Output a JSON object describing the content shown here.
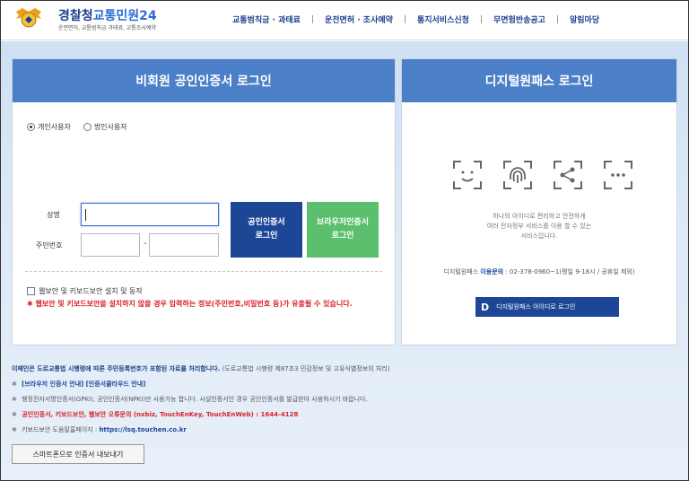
{
  "header": {
    "logo_title_main": "경찰청",
    "logo_title_accent": "교통민원24",
    "logo_sub": "운전면허, 교통범칙금 과태료, 교통조사예약",
    "nav": [
      "교통범칙금 · 과태료",
      "운전면허 · 조사예약",
      "통지서비스신청",
      "무면험반송공고",
      "알림마당"
    ]
  },
  "left_panel": {
    "title": "비회원 공인인증서 로그인",
    "radio_personal": "개인사용자",
    "radio_corporate": "법인사용자",
    "name_label": "성명",
    "rrn_label": "주민번호",
    "dash": "-",
    "cert_login_label": "공인인증서\n로그인",
    "browser_cert_label": "브라우저인증서\n로그인",
    "checkbox_label": "웹보안 및 키보드보안 설치 및 동작",
    "warning": "✱ 웹보안 및 키보드보안을 설치하지 않을 경우 입력하는 정보(주민번호,비밀번호 등)가 유출될 수 있습니다."
  },
  "right_panel": {
    "title": "디지털원패스 로그인",
    "desc_line1": "하나의 아이디로 편리하고 안전하게",
    "desc_line2": "여러 전자정부 서비스를 이용 할 수 있는",
    "desc_line3": "서비스입니다.",
    "contact_prefix": "디지털원패스",
    "contact_hl": "이용문의",
    "contact_suffix": ": 02-378-0960~1(평일 9-18시 / 공휴일 제외)",
    "button_d": "D",
    "button_label": "디지털원패스 아이디로 로그인"
  },
  "notes": {
    "n1_main": "이페인은 도로교통법 시행령에 따른 주민등록번호가 포함된 자료를 처리합니다.",
    "n1_gray": "(도로교통법 시행령 제87조3 민감정보 및 고유식별정보의 처리)",
    "n2_link1": "[브라우저 인증서 안내]",
    "n2_link2": "[인증서클라우드 안내]",
    "n3": "행정전자서명인증서(GPKI), 공인인증서(NPKI)만 사용가능 합니다. 사설인증서인 경우 공인인증서를 발급받아 사용하시기 바랍니다.",
    "n4": "공인인증서, 키보드보안, 웹보안 오류문의 (nxbiz, TouchEnKey, TouchEnWeb) : 1644-4128",
    "n5_prefix": "키보드보안 도움말홈페이지 :",
    "n5_url": "https://lsq.touchen.co.kr",
    "mark": "✱",
    "smart_button": "스마트폰으로 인증서 내보내기"
  }
}
